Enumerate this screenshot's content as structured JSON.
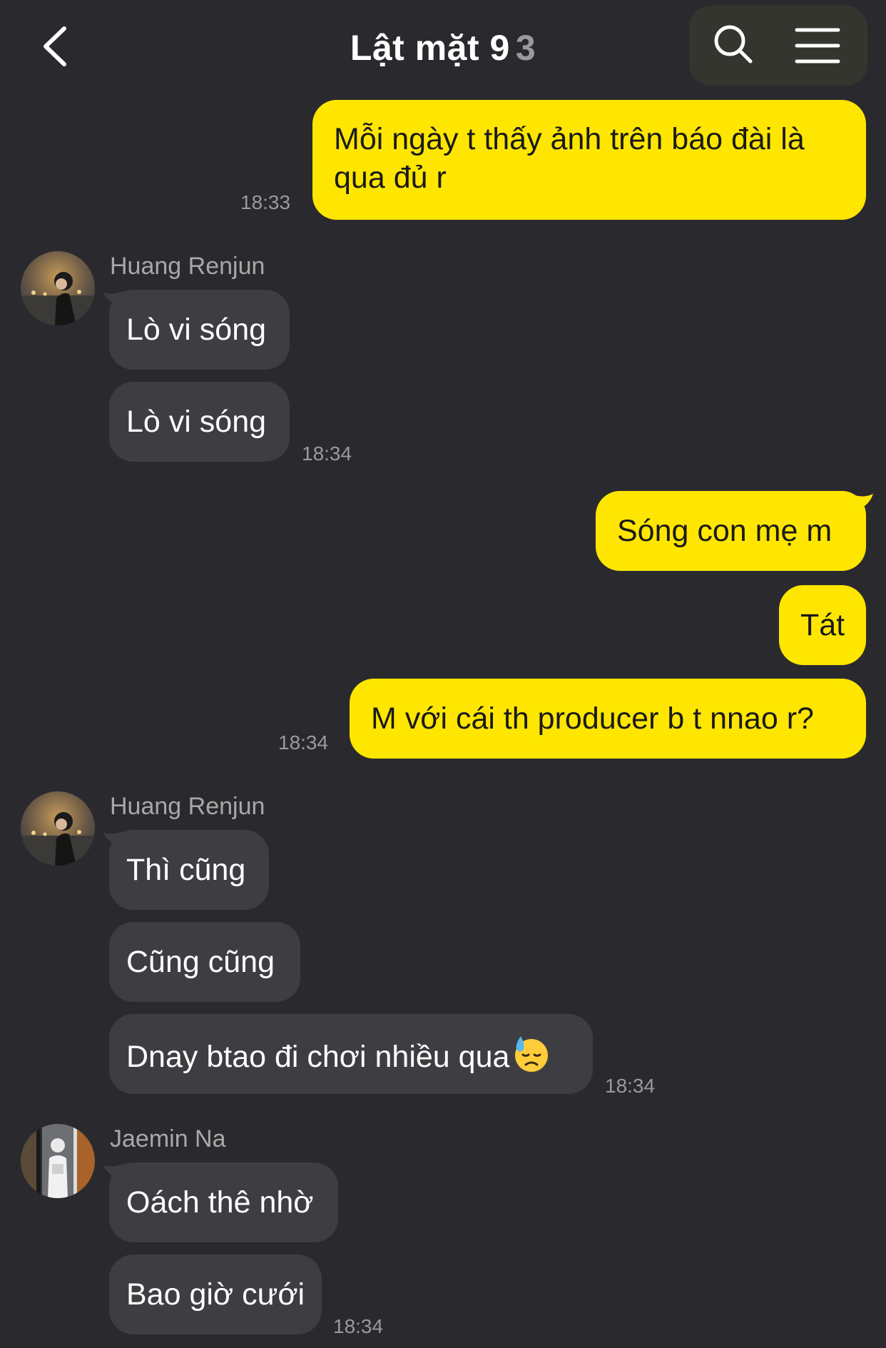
{
  "header": {
    "title": "Lật mặt 9",
    "member_count": "3"
  },
  "icons": {
    "back": "chevron-left-icon",
    "search": "search-icon",
    "menu": "hamburger-menu-icon",
    "sweat_emoji": "downcast-face-with-sweat-emoji"
  },
  "colors": {
    "background": "#2a2a2e",
    "my_bubble": "#ffe600",
    "other_bubble": "#3e3e42",
    "muted_text": "#9a9a9a"
  },
  "messages": [
    {
      "from": "me",
      "text": "Mỗi ngày t thấy ảnh trên báo đài là\nqua đủ r",
      "time": "18:33"
    },
    {
      "from": "Huang Renjun",
      "text": "Lò vi sóng"
    },
    {
      "from": "Huang Renjun",
      "text": "Lò vi sóng",
      "time": "18:34"
    },
    {
      "from": "me",
      "text": "Sóng con mẹ m"
    },
    {
      "from": "me",
      "text": "Tát"
    },
    {
      "from": "me",
      "text": "M với cái th producer b t nnao r?",
      "time": "18:34"
    },
    {
      "from": "Huang Renjun",
      "text": "Thì cũng"
    },
    {
      "from": "Huang Renjun",
      "text": "Cũng cũng"
    },
    {
      "from": "Huang Renjun",
      "text": "Dnay btao đi chơi nhiều qua",
      "time": "18:34"
    },
    {
      "from": "Jaemin Na",
      "text": "Oách thê nhờ"
    },
    {
      "from": "Jaemin Na",
      "text": "Bao giờ cưới",
      "time": "18:34"
    }
  ]
}
